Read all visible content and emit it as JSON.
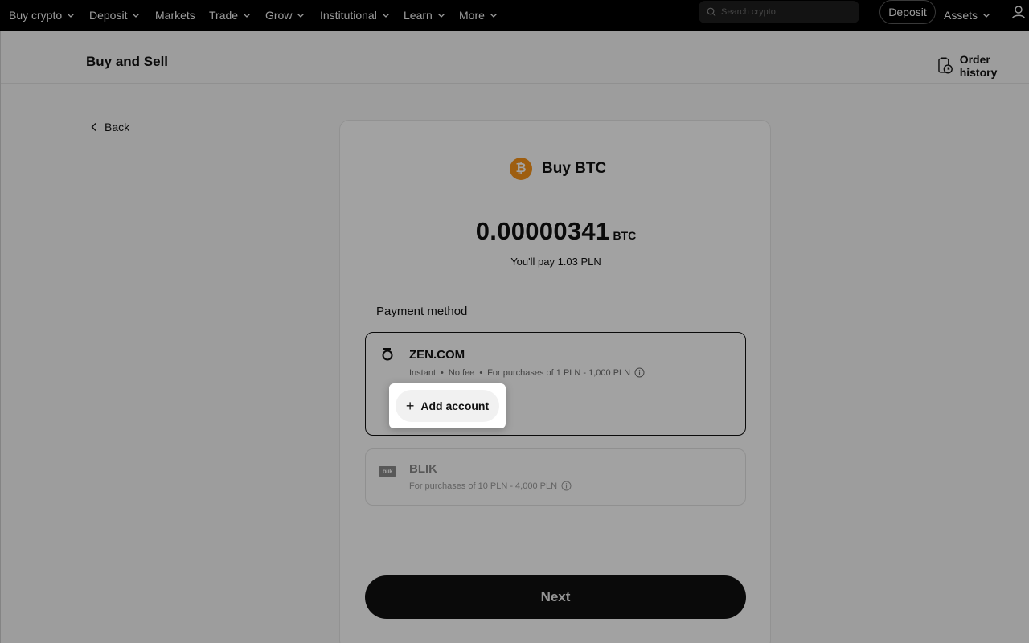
{
  "topnav": {
    "items": [
      {
        "label": "Buy crypto",
        "has_menu": true
      },
      {
        "label": "Deposit",
        "has_menu": true
      },
      {
        "label": "Markets",
        "has_menu": false
      },
      {
        "label": "Trade",
        "has_menu": true
      },
      {
        "label": "Grow",
        "has_menu": true
      },
      {
        "label": "Institutional",
        "has_menu": true
      },
      {
        "label": "Learn",
        "has_menu": true
      },
      {
        "label": "More",
        "has_menu": true
      }
    ],
    "search_placeholder": "Search crypto",
    "deposit_label": "Deposit",
    "assets_label": "Assets"
  },
  "header": {
    "title": "Buy and Sell",
    "order_history_label": "Order history"
  },
  "back_label": "Back",
  "purchase": {
    "title": "Buy BTC",
    "coin_symbol": "₿",
    "amount": "0.00000341",
    "amount_unit": "BTC",
    "pay_text": "You'll pay 1.03 PLN"
  },
  "payment": {
    "label": "Payment method",
    "options": [
      {
        "name": "ZEN.COM",
        "meta": [
          "Instant",
          "No fee",
          "For purchases of 1 PLN - 1,000 PLN"
        ],
        "selected": true
      },
      {
        "name": "BLIK",
        "logo_text": "blik",
        "meta": [
          "For purchases of 10 PLN - 4,000 PLN"
        ],
        "selected": false
      }
    ],
    "add_account_label": "Add account"
  },
  "next_label": "Next",
  "colors": {
    "nav_bg": "#000000",
    "btc_orange": "#f7931a",
    "primary_button": "#111111"
  }
}
